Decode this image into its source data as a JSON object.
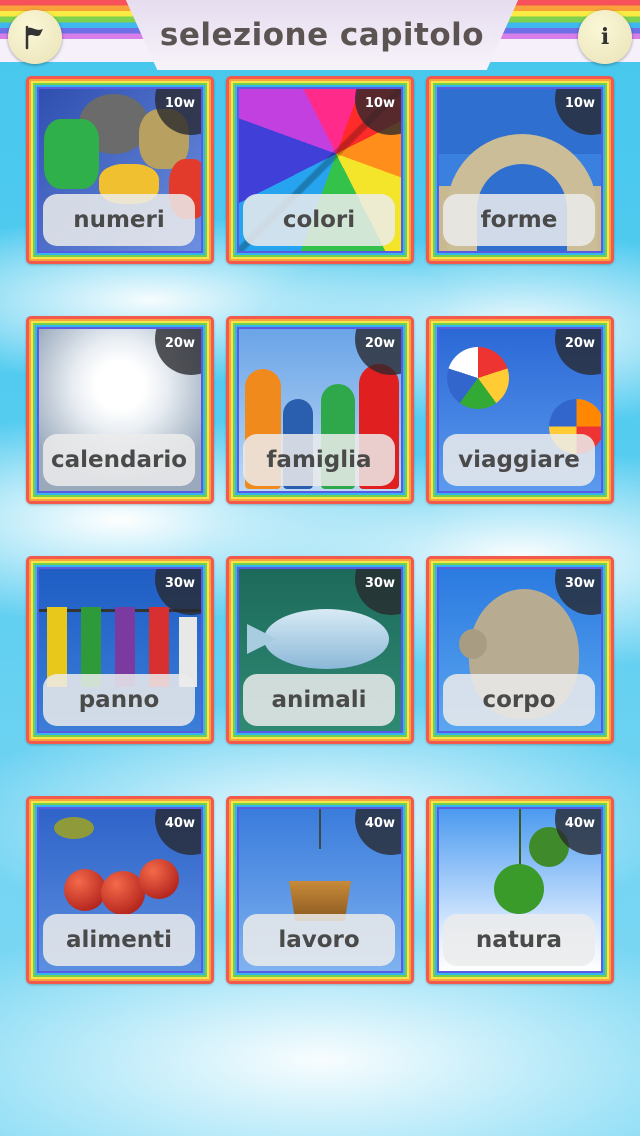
{
  "header": {
    "title": "selezione capitolo",
    "flag_icon": "flag-icon",
    "info_label": "i"
  },
  "chapters": [
    {
      "label": "numeri",
      "badge": "10w"
    },
    {
      "label": "colori",
      "badge": "10w"
    },
    {
      "label": "forme",
      "badge": "10w"
    },
    {
      "label": "calendario",
      "badge": "20w"
    },
    {
      "label": "famiglia",
      "badge": "20w"
    },
    {
      "label": "viaggiare",
      "badge": "20w"
    },
    {
      "label": "panno",
      "badge": "30w"
    },
    {
      "label": "animali",
      "badge": "30w"
    },
    {
      "label": "corpo",
      "badge": "30w"
    },
    {
      "label": "alimenti",
      "badge": "40w"
    },
    {
      "label": "lavoro",
      "badge": "40w"
    },
    {
      "label": "natura",
      "badge": "40w"
    }
  ]
}
